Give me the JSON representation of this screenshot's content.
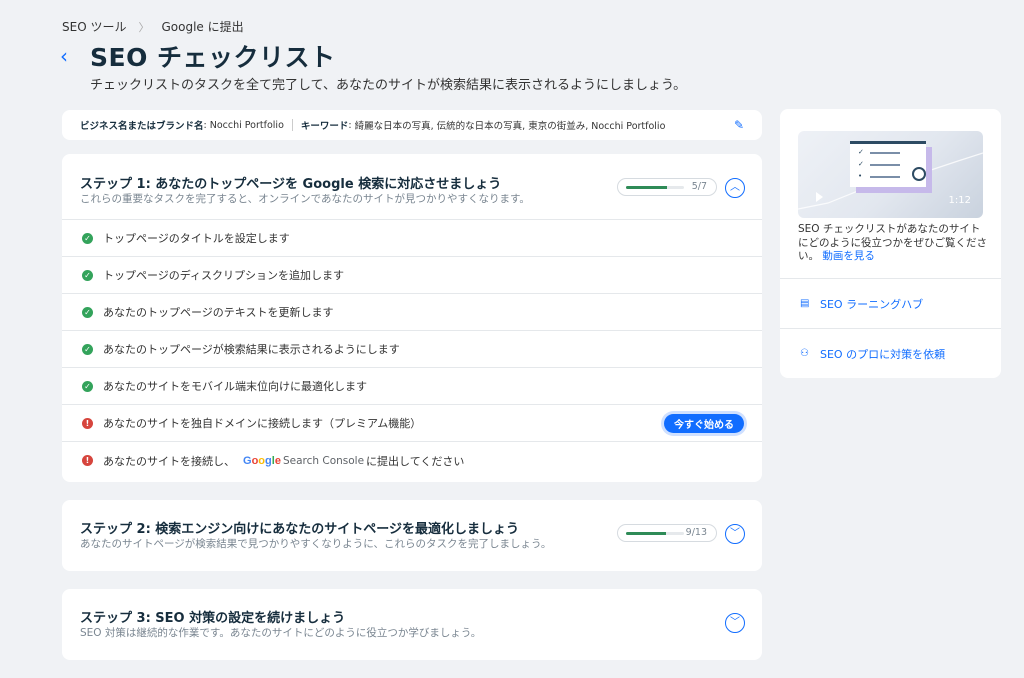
{
  "breadcrumb": [
    "SEO ツール",
    "Google に提出"
  ],
  "header": {
    "title": "SEO チェックリスト",
    "subtitle": "チェックリストのタスクを全て完了して、あなたのサイトが検索結果に表示されるようにしましょう。"
  },
  "brand": {
    "label": "ビジネス名またはブランド名",
    "value": "Nocchi Portfolio",
    "keyword_label": "キーワード",
    "keywords": "綺麗な日本の写真, 伝統的な日本の写真, 東京の街並み, Nocchi Portfolio"
  },
  "steps": [
    {
      "title": "ステップ 1: あなたのトップページを Google 検索に対応させましょう",
      "desc": "これらの重要なタスクを完了すると、オンラインであなたのサイトが見つかりやすくなります。",
      "progress_text": "5/7",
      "progress": 0.714,
      "expanded": true,
      "tasks": [
        {
          "label": "トップページのタイトルを設定します",
          "status": "done"
        },
        {
          "label": "トップページのディスクリプションを追加します",
          "status": "done"
        },
        {
          "label": "あなたのトップページのテキストを更新します",
          "status": "done"
        },
        {
          "label": "あなたのトップページが検索結果に表示されるようにします",
          "status": "done"
        },
        {
          "label": "あなたのサイトをモバイル端末位向けに最適化します",
          "status": "done"
        },
        {
          "label": "あなたのサイトを独自ドメインに接続します（プレミアム機能）",
          "status": "todo",
          "action": "今すぐ始める"
        },
        {
          "label_before": "あなたのサイトを接続し、",
          "logo": "Google",
          "logo_suffix": "Search Console",
          "label_after": "に提出してください",
          "status": "todo"
        }
      ]
    },
    {
      "title": "ステップ 2: 検索エンジン向けにあなたのサイトページを最適化しましょう",
      "desc": "あなたのサイトページが検索結果で見つかりやすくなりように、これらのタスクを完了しましょう。",
      "progress_text": "9/13",
      "progress": 0.692,
      "expanded": false
    },
    {
      "title": "ステップ 3: SEO 対策の設定を続けましょう",
      "desc": "SEO 対策は継続的な作業です。あなたのサイトにどのように役立つか学びましょう。",
      "expanded": false
    }
  ],
  "sidebar": {
    "video_duration": "1:12",
    "video_text": "SEO チェックリストがあなたのサイトにどのように役立つかをぜひご覧ください。",
    "video_link": "動画を見る",
    "links": [
      "SEO ラーニングハブ",
      "SEO のプロに対策を依頼"
    ]
  },
  "colors": {
    "accent": "#116dff",
    "done": "#33a35b",
    "warn": "#d6453d",
    "progress": "#2e8b57"
  }
}
